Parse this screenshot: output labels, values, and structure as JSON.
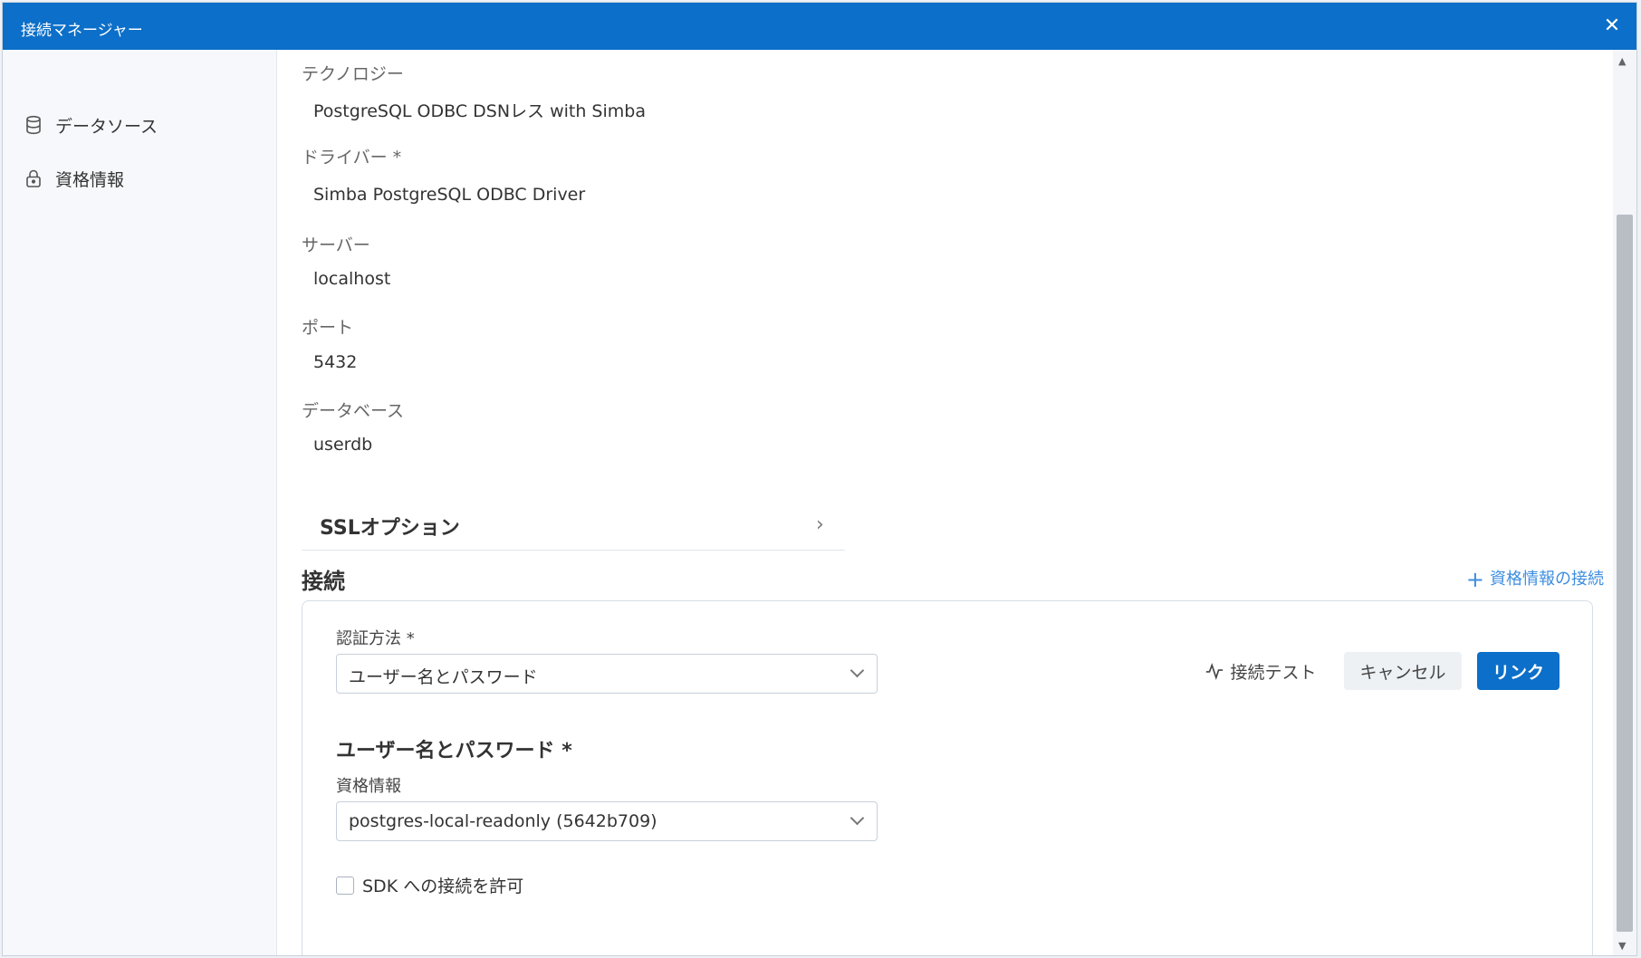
{
  "window": {
    "title": "接続マネージャー",
    "close_icon": "close-icon"
  },
  "sidebar": {
    "items": [
      {
        "label": "データソース",
        "icon": "database-icon"
      },
      {
        "label": "資格情報",
        "icon": "lock-icon"
      }
    ]
  },
  "fields": [
    {
      "label": "テクノロジー",
      "value": "PostgreSQL ODBC DSNレス with Simba"
    },
    {
      "label": "ドライバー *",
      "value": "Simba PostgreSQL ODBC Driver"
    },
    {
      "label": "サーバー",
      "value": "localhost"
    },
    {
      "label": "ポート",
      "value": "5432"
    },
    {
      "label": "データベース",
      "value": "userdb"
    }
  ],
  "ssl": {
    "label": "SSLオプション"
  },
  "connection": {
    "title": "接続",
    "add_credential": "資格情報の接続",
    "auth_label": "認証方法 *",
    "auth_value": "ユーザー名とパスワード",
    "test_button": "接続テスト",
    "cancel_button": "キャンセル",
    "link_button": "リンク",
    "userpass_title": "ユーザー名とパスワード *",
    "cred_label": "資格情報",
    "cred_value": "postgres-local-readonly (5642b709)",
    "sdk_checkbox_label": "SDK への接続を許可",
    "sdk_checked": false
  },
  "colors": {
    "accent": "#0c6fc9",
    "link": "#3d8ee0"
  }
}
